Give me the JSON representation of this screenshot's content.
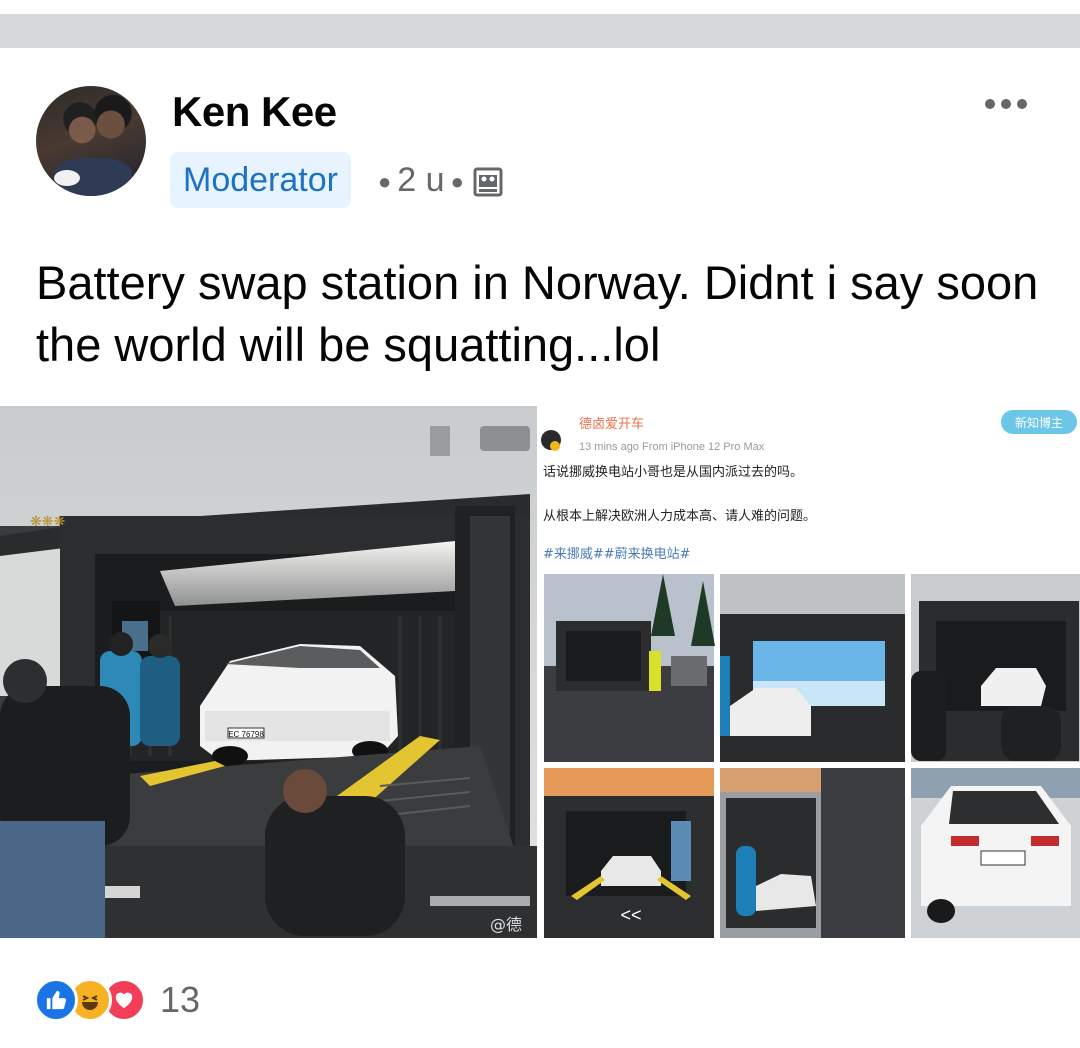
{
  "post": {
    "author": {
      "name": "Ken Kee",
      "role_badge": "Moderator",
      "time": "2 u",
      "avatar_icon": "avatar-photo"
    },
    "text": "Battery swap station in Norway. Didnt i say soon the world will be squatting...lol",
    "more_icon": "ellipsis-icon",
    "audience_icon": "gallery-icon"
  },
  "embedded_weibo": {
    "username": "德卤爱开车",
    "follow_label": "新知博主",
    "time_source": "13 mins ago  From iPhone 12 Pro Max",
    "line1": "话说挪威换电站小哥也是从国内派过去的吗。",
    "line2": "从根本上解决欧洲人力成本高、请人难的问题。",
    "hashtags": "#来挪威##蔚来换电站#",
    "plate_text": "EC 76798",
    "watermark": "@德"
  },
  "reactions": {
    "count": "13",
    "types": [
      "like",
      "haha",
      "love"
    ]
  },
  "colors": {
    "accent": "#1d72c4",
    "badge_bg": "#e7f3ff",
    "muted": "#65676b",
    "like": "#1b74e4",
    "haha": "#f7b125",
    "love": "#f33e58"
  }
}
